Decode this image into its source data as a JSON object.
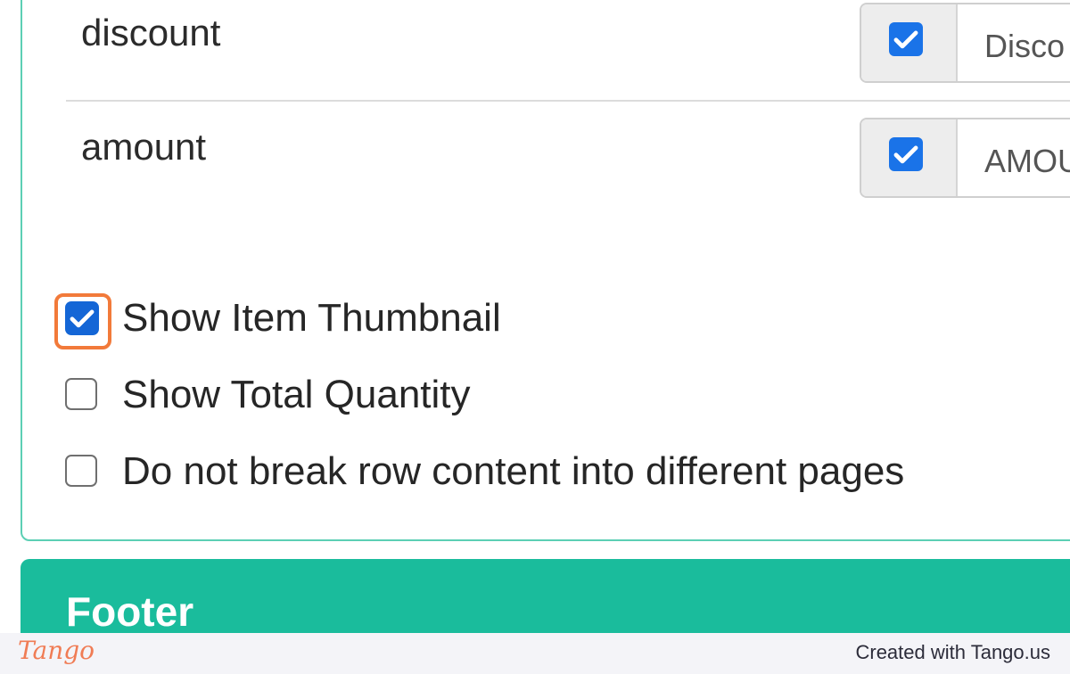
{
  "columns": {
    "rows": [
      {
        "name": "discount",
        "enabled": true,
        "input_value": "Disco"
      },
      {
        "name": "amount",
        "enabled": true,
        "input_value": "AMOU"
      }
    ]
  },
  "options": {
    "show_item_thumbnail": {
      "label": "Show Item Thumbnail",
      "checked": true
    },
    "show_total_quantity": {
      "label": "Show Total Quantity",
      "checked": false
    },
    "no_break_rows": {
      "label": "Do not break row content into different pages",
      "checked": false
    }
  },
  "footer": {
    "title": "Footer"
  },
  "tango": {
    "logo": "Tango",
    "credit": "Created with Tango.us"
  },
  "colors": {
    "accent_teal": "#1abc9c",
    "checkbox_blue": "#1466d6",
    "highlight_orange": "#f27a3a",
    "tango_orange": "#f07c55"
  }
}
